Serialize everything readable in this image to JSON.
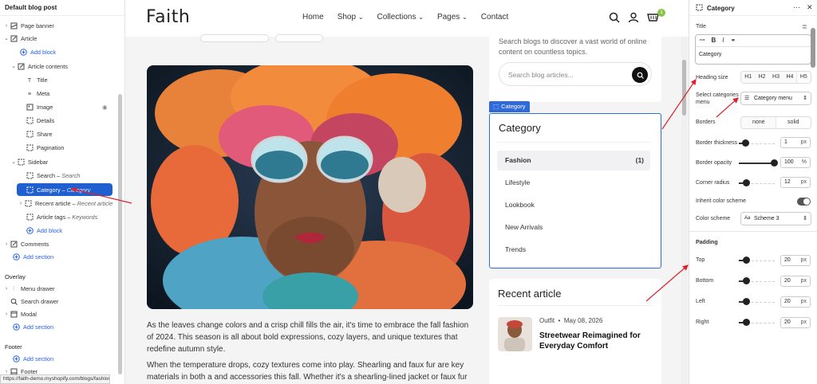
{
  "left_panel": {
    "title": "Default blog post",
    "rows": [
      {
        "label": "Page banner",
        "sub": ""
      },
      {
        "label": "Article",
        "sub": ""
      },
      {
        "label": "Add block",
        "sub": ""
      },
      {
        "label": "Article contents",
        "sub": ""
      },
      {
        "label": "Title",
        "sub": ""
      },
      {
        "label": "Meta",
        "sub": ""
      },
      {
        "label": "Image",
        "sub": ""
      },
      {
        "label": "Details",
        "sub": ""
      },
      {
        "label": "Share",
        "sub": ""
      },
      {
        "label": "Pagination",
        "sub": ""
      },
      {
        "label": "Sidebar",
        "sub": ""
      },
      {
        "label": "Search",
        "sub": "Search"
      },
      {
        "label": "Category",
        "sub": "Category"
      },
      {
        "label": "Recent article",
        "sub": "Recent article"
      },
      {
        "label": "Article tags",
        "sub": "Keywords"
      },
      {
        "label": "Add block",
        "sub": ""
      },
      {
        "label": "Comments",
        "sub": ""
      },
      {
        "label": "Add section",
        "sub": ""
      },
      {
        "label": "Menu drawer",
        "sub": ""
      },
      {
        "label": "Search drawer",
        "sub": ""
      },
      {
        "label": "Modal",
        "sub": ""
      },
      {
        "label": "Add section",
        "sub": ""
      },
      {
        "label": "Add section",
        "sub": ""
      },
      {
        "label": "Footer",
        "sub": ""
      }
    ],
    "overlay_title": "Overlay",
    "footer_title": "Footer",
    "status_url": "https://faith-demo.myshopify.com/blogs/fashion"
  },
  "site": {
    "logo": "Faith",
    "nav": [
      "Home",
      "Shop",
      "Collections",
      "Pages",
      "Contact"
    ],
    "cart_count": "1",
    "search_desc": "Search blogs to discover a vast world of online content on countless topics.",
    "search_placeholder": "Search blog articles...",
    "article_p1": "As the leaves change colors and a crisp chill fills the air, it's time to embrace the fall fashion of 2024. This season is all about bold expressions, cozy layers, and unique textures that redefine autumn style.",
    "article_p2": "When the temperature drops, cozy textures come into play. Shearling and faux fur are key materials in both a and accessories this fall. Whether it's a shearling-lined jacket or faux fur",
    "category_tag": "Category",
    "category_title": "Category",
    "categories": [
      {
        "name": "Fashion",
        "count": "(1)"
      },
      {
        "name": "Lifestyle",
        "count": ""
      },
      {
        "name": "Lookbook",
        "count": ""
      },
      {
        "name": "New Arrivals",
        "count": ""
      },
      {
        "name": "Trends",
        "count": ""
      }
    ],
    "recent_title": "Recent article",
    "recent_tag": "Outfit",
    "recent_date": "May 08, 2026",
    "recent_headline": "Streetwear Reimagined for Everyday Comfort"
  },
  "right_panel": {
    "title": "Category",
    "title_label": "Title",
    "title_value": "Category",
    "heading_size_label": "Heading size",
    "heading_sizes": [
      "H1",
      "H2",
      "H3",
      "H4",
      "H5"
    ],
    "select_menu_label": "Select categories menu",
    "select_menu_value": "Category menu",
    "borders_label": "Borders",
    "borders_options": [
      "none",
      "solid"
    ],
    "border_thickness_label": "Border thickness",
    "border_thickness": "1",
    "border_opacity_label": "Border opacity",
    "border_opacity": "100",
    "corner_radius_label": "Corner radius",
    "corner_radius": "12",
    "inherit_label": "Inherit color scheme",
    "color_scheme_label": "Color scheme",
    "color_scheme_value": "Scheme 3",
    "padding_title": "Padding",
    "pad_top_label": "Top",
    "pad_top": "20",
    "pad_bottom_label": "Bottom",
    "pad_bottom": "20",
    "pad_left_label": "Left",
    "pad_left": "20",
    "pad_right_label": "Right",
    "pad_right": "20",
    "unit_px": "px",
    "unit_pct": "%"
  },
  "colors": {
    "accent": "#2f6ad9",
    "annotation": "#d9232e"
  }
}
